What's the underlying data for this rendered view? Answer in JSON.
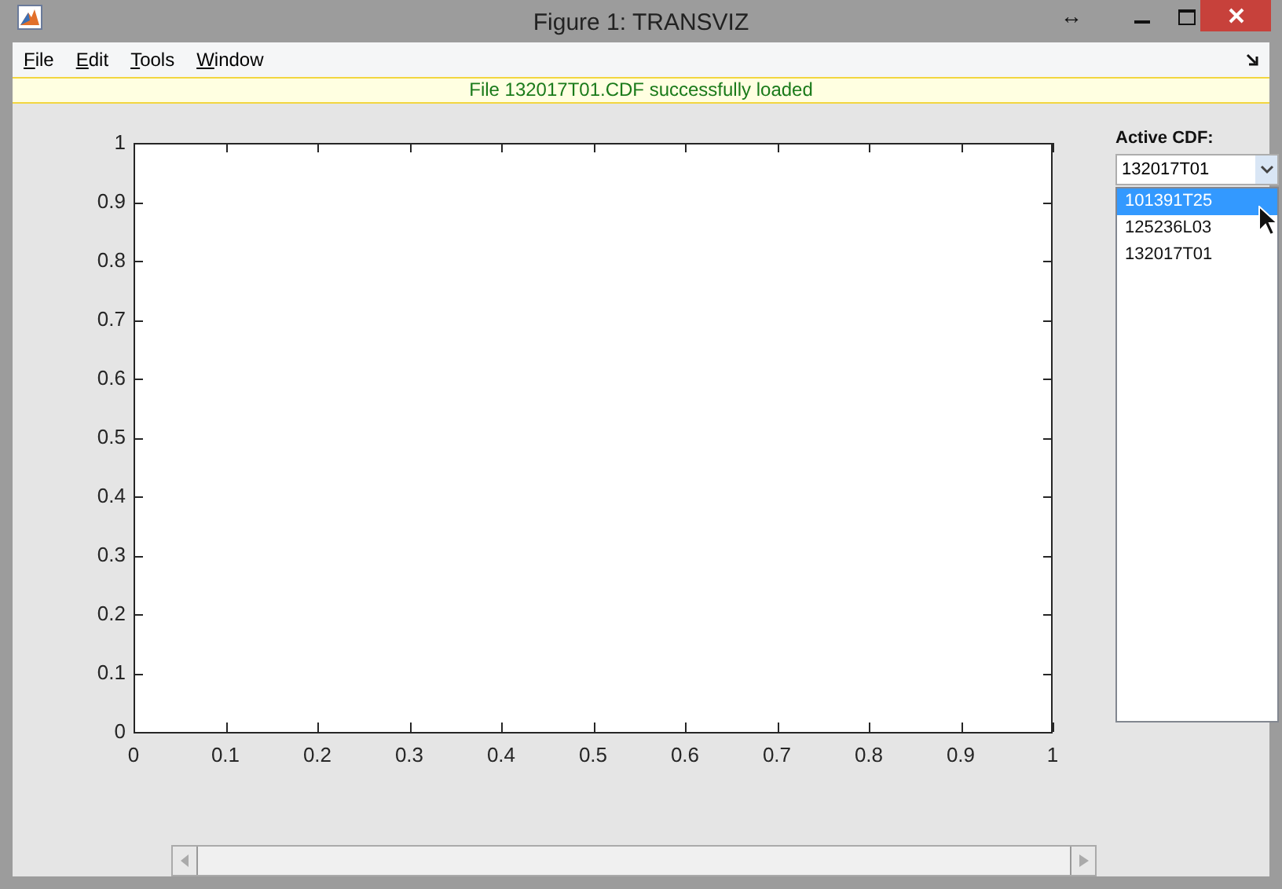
{
  "window": {
    "title": "Figure 1: TRANSVIZ",
    "resize_glyph": "↔"
  },
  "menu": [
    {
      "label": "File"
    },
    {
      "label": "Edit"
    },
    {
      "label": "Tools"
    },
    {
      "label": "Window"
    }
  ],
  "info_bar": "File 132017T01.CDF successfully loaded",
  "chart_data": {
    "type": "line",
    "xlim": [
      0,
      1
    ],
    "ylim": [
      0,
      1
    ],
    "xticks": [
      0,
      0.1,
      0.2,
      0.3,
      0.4,
      0.5,
      0.6,
      0.7,
      0.8,
      0.9,
      1
    ],
    "yticks": [
      0,
      0.1,
      0.2,
      0.3,
      0.4,
      0.5,
      0.6,
      0.7,
      0.8,
      0.9,
      1
    ]
  },
  "side_panel": {
    "label": "Active CDF:",
    "combo_value": "132017T01",
    "options": [
      {
        "label": "101391T25",
        "selected": true
      },
      {
        "label": "125236L03",
        "selected": false
      },
      {
        "label": "132017T01",
        "selected": false
      }
    ]
  }
}
